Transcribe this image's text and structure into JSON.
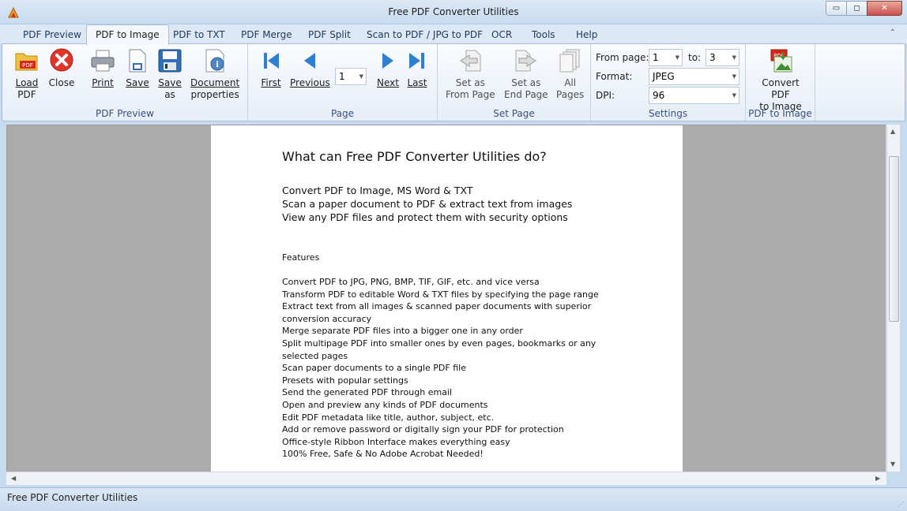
{
  "window": {
    "title": "Free PDF Converter Utilities",
    "app_icon": "app-logo-icon",
    "minimize_glyph": "▭",
    "maximize_glyph": "◻",
    "close_glyph": "✕"
  },
  "tabs": [
    {
      "label": "PDF Preview",
      "active": false
    },
    {
      "label": "PDF to Image",
      "active": true
    },
    {
      "label": "PDF to TXT",
      "active": false
    },
    {
      "label": "PDF Merge",
      "active": false
    },
    {
      "label": "PDF Split",
      "active": false
    },
    {
      "label": "Scan to PDF / JPG to PDF",
      "active": false
    },
    {
      "label": "OCR",
      "active": false
    },
    {
      "label": "Tools",
      "active": false
    },
    {
      "label": "Help",
      "active": false
    }
  ],
  "ribbon": {
    "pdf_preview": {
      "label": "PDF Preview",
      "load_line1": "Load",
      "load_line2": "PDF",
      "close": "Close",
      "print": "Print",
      "save": "Save",
      "saveas_line1": "Save",
      "saveas_line2": "as",
      "docprops_line1": "Document",
      "docprops_line2": "properties"
    },
    "page": {
      "label": "Page",
      "first": "First",
      "previous": "Previous",
      "current_page": "1",
      "next": "Next",
      "last": "Last"
    },
    "set_page": {
      "label": "Set Page",
      "from_line1": "Set as",
      "from_line2": "From Page",
      "end_line1": "Set as",
      "end_line2": "End Page",
      "all_line1": "All",
      "all_line2": "Pages"
    },
    "settings": {
      "label": "Settings",
      "from_page_label": "From page:",
      "from_page_value": "1",
      "to_label": "to:",
      "to_value": "3",
      "format_label": "Format:",
      "format_value": "JPEG",
      "dpi_label": "DPI:",
      "dpi_value": "96"
    },
    "pdf_to_image": {
      "label": "PDF to Image",
      "convert_line1": "Convert PDF",
      "convert_line2": "to Image"
    }
  },
  "document": {
    "heading": "What can Free PDF Converter Utilities do?",
    "intro": [
      "Convert PDF to Image, MS Word & TXT",
      "Scan a paper document to PDF & extract text from images",
      "View any PDF files and protect them with security options"
    ],
    "features_title": "Features",
    "features": [
      "Convert PDF to JPG, PNG, BMP, TIF, GIF, etc. and vice versa",
      "Transform PDF to editable Word & TXT files by specifying the page range",
      "Extract text from all images & scanned paper documents with superior conversion accuracy",
      "Merge separate PDF files into a bigger one in any order",
      "Split multipage PDF into smaller ones by even pages, bookmarks or any selected pages",
      "Scan paper documents to a single PDF file",
      "Presets with popular settings",
      "Send the generated PDF through email",
      "Open and preview any kinds of PDF documents",
      "Edit PDF metadata like title, author, subject, etc.",
      "Add or remove password or digitally sign your PDF for protection",
      "Office-style Ribbon Interface makes everything easy",
      "100% Free, Safe & No Adobe Acrobat Needed!"
    ]
  },
  "statusbar": {
    "text": "Free PDF Converter Utilities"
  },
  "colors": {
    "ribbon_bg": "#e6eef8",
    "doc_bg": "#ababab",
    "close_red": "#c75050",
    "nav_blue": "#2f7fd0"
  }
}
